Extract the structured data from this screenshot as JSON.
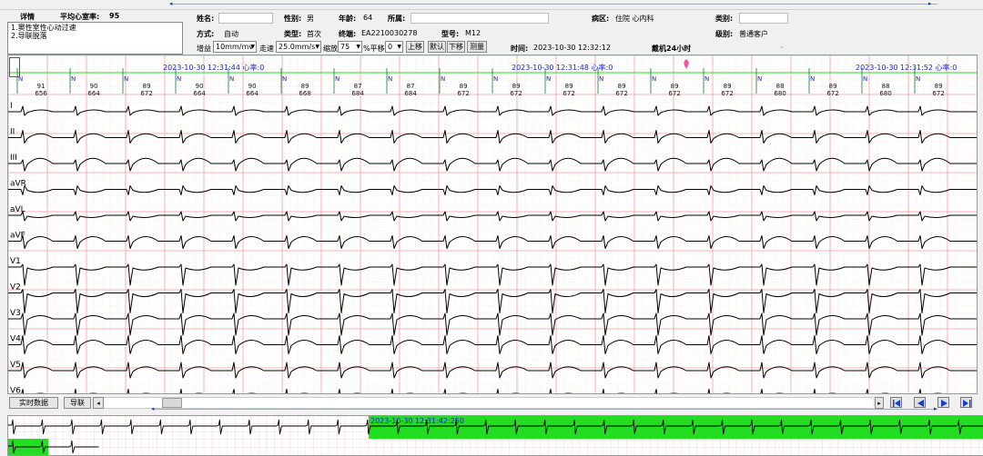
{
  "header": {
    "detail_label": "详情",
    "avg_hr_label": "平均心室率:",
    "avg_hr_value": "95",
    "diagnosis": [
      "1.窦性室性心动过速",
      "2.导联脱落"
    ]
  },
  "patient": {
    "name_label": "姓名:",
    "name_value": "",
    "gender_label": "性别:",
    "gender_value": "男",
    "age_label": "年龄:",
    "age_value": "64",
    "hospital_label": "所属:",
    "hospital_value": "",
    "ward_label": "病区:",
    "ward_value": "住院 心内科",
    "category_label": "类别:",
    "category_value": "",
    "mode_label": "方式:",
    "mode_value": "自动",
    "type_label": "类型:",
    "type_value": "首次",
    "terminal_label": "终端:",
    "terminal_value": "EA2210030278",
    "model_label": "型号:",
    "model_value": "M12",
    "level_label": "级别:",
    "level_value": "普通客户"
  },
  "toolbar": {
    "gain_label": "增益",
    "gain_value": "10mm/mv",
    "speed_label": "走速",
    "speed_value": "25.0mm/s",
    "zoom_label": "缩放",
    "zoom_value": "75",
    "pan_label": "%平移",
    "pan_value": "0",
    "up_label": "上移",
    "default_label": "默认",
    "down_label": "下移",
    "measure_label": "测量",
    "time_label": "时间:",
    "time_value": "2023-10-30 12:32:12",
    "wear_label": "戴机24小时"
  },
  "ecg": {
    "markers": [
      {
        "time": "2023-10-30 12:31:44",
        "hr_label": "心率:",
        "hr_value": "0"
      },
      {
        "time": "2023-10-30 12:31:48",
        "hr_label": "心率:",
        "hr_value": "0"
      },
      {
        "time": "2023-10-30 12:31:52",
        "hr_label": "心率:",
        "hr_value": "0"
      }
    ],
    "beats": [
      {
        "hr": "91",
        "rr": "656"
      },
      {
        "hr": "90",
        "rr": "664"
      },
      {
        "hr": "89",
        "rr": "672"
      },
      {
        "hr": "90",
        "rr": "664"
      },
      {
        "hr": "90",
        "rr": "664"
      },
      {
        "hr": "89",
        "rr": "668"
      },
      {
        "hr": "87",
        "rr": "684"
      },
      {
        "hr": "87",
        "rr": "684"
      },
      {
        "hr": "89",
        "rr": "672"
      },
      {
        "hr": "89",
        "rr": "672"
      },
      {
        "hr": "89",
        "rr": "672"
      },
      {
        "hr": "89",
        "rr": "672"
      },
      {
        "hr": "89",
        "rr": "672"
      },
      {
        "hr": "89",
        "rr": "672"
      },
      {
        "hr": "88",
        "rr": "680"
      },
      {
        "hr": "89",
        "rr": "672"
      },
      {
        "hr": "88",
        "rr": "680"
      },
      {
        "hr": "89",
        "rr": "672"
      }
    ],
    "beat_label": "N",
    "leads": [
      "I",
      "II",
      "III",
      "aVR",
      "aVL",
      "aVF",
      "V1",
      "V2",
      "V3",
      "V4",
      "V5",
      "V6"
    ]
  },
  "bottom": {
    "realtime_label": "实时数据",
    "lead_label": "导联",
    "strip_time": "2023-10-30 12:31:42:250"
  },
  "colors": {
    "grid_major": "#f4a0a0",
    "grid_minor": "#fbd6d6",
    "highlight": "#22dd22",
    "timestamp": "#2222cc",
    "beat_line": "#0a7a2a"
  }
}
